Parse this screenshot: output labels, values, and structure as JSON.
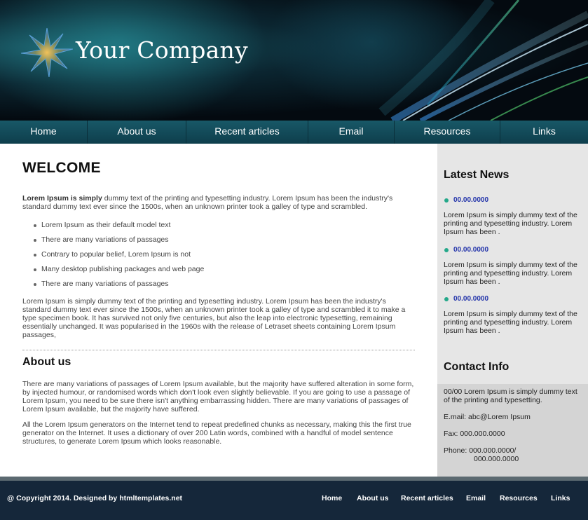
{
  "header": {
    "brand": "Your Company"
  },
  "nav": [
    {
      "label": "Home"
    },
    {
      "label": "About us"
    },
    {
      "label": "Recent articles"
    },
    {
      "label": "Email"
    },
    {
      "label": "Resources"
    },
    {
      "label": "Links"
    }
  ],
  "main": {
    "welcome_title": "WELCOME",
    "intro_bold": "Lorem Ipsum is simply",
    "intro_rest": " dummy text of the printing and typesetting industry. Lorem Ipsum has been the industry's standard dummy text ever since the 1500s, when an unknown printer took a galley of type and scrambled.",
    "bullets": [
      "Lorem Ipsum as their default model text",
      "There are many variations of passages",
      "Contrary to popular belief, Lorem Ipsum is not",
      "Many desktop publishing packages and web page",
      "There are many variations of passages"
    ],
    "paragraph2": "Lorem Ipsum is simply dummy text of the printing and typesetting industry. Lorem Ipsum has been the industry's standard dummy text ever since the 1500s, when an unknown printer took a galley of type and scrambled it to make a type specimen book. It has survived not only five centuries, but also the leap into electronic typesetting, remaining essentially unchanged. It was popularised in the 1960s with the release of Letraset sheets containing Lorem Ipsum passages,",
    "about_title": "About us",
    "about_p1": "There are many variations of passages of Lorem Ipsum available, but the majority have suffered alteration in some form, by injected humour, or randomised words which don't look even slightly believable. If you are going to use a passage of Lorem Ipsum, you need to be sure there isn't anything embarrassing hidden. There are many variations of passages of Lorem Ipsum available, but the majority have suffered.",
    "about_p2": "All the Lorem Ipsum generators on the Internet tend to repeat predefined chunks as necessary, making this the first true generator on the Internet. It uses a dictionary of over 200 Latin words, combined with a handful of model sentence structures, to generate Lorem Ipsum which looks reasonable."
  },
  "sidebar": {
    "news_title": "Latest News",
    "news": [
      {
        "date": "00.00.0000",
        "text": "Lorem Ipsum is simply dummy text of the printing and typesetting industry. Lorem Ipsum has been ."
      },
      {
        "date": "00.00.0000",
        "text": "Lorem Ipsum is simply dummy text of the printing and typesetting industry. Lorem Ipsum has been ."
      },
      {
        "date": "00.00.0000",
        "text": "Lorem Ipsum is simply dummy text of the printing and typesetting industry. Lorem Ipsum has been ."
      }
    ],
    "contact_title": "Contact Info",
    "contact": {
      "address": "00/00 Lorem Ipsum is simply dummy text of the printing and typesetting.",
      "email": "E.mail:  abc@Lorem Ipsum",
      "fax": "Fax: 000.000.0000",
      "phone_line1": "Phone: 000.000.0000/",
      "phone_line2": "000.000.0000"
    }
  },
  "footer": {
    "copyright": "@ Copyright 2014. Designed by htmltemplates.net",
    "links": [
      "Home",
      "About us",
      "Recent articles",
      "Email",
      "Resources",
      "Links"
    ]
  },
  "colors": {
    "nav_bg": "#185867",
    "footer_bg": "#15273a",
    "news_bullet": "#24a88a",
    "news_date": "#2233aa",
    "sidebar_bg": "#e6e6e6"
  },
  "icons": {
    "logo": "starburst-logo-icon",
    "news_bullet": "bullet-dot-icon"
  }
}
